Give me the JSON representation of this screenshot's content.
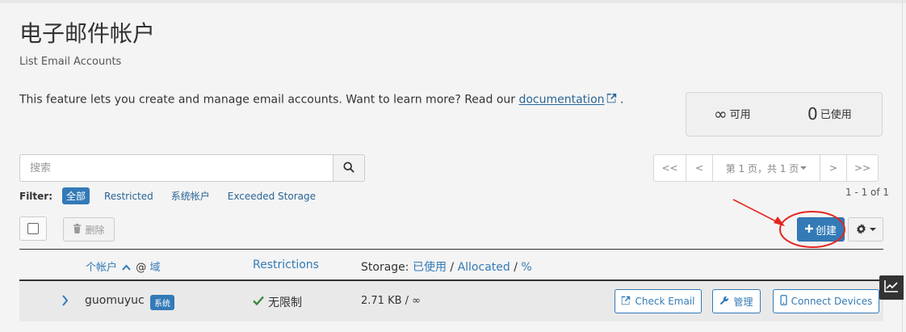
{
  "header": {
    "title": "电子邮件帐户",
    "subtitle": "List Email Accounts"
  },
  "intro": {
    "text": "This feature lets you create and manage email accounts. Want to learn more? Read our ",
    "link_label": "documentation",
    "trailing": "."
  },
  "stats": {
    "available_value": "∞",
    "available_label": "可用",
    "used_value": "0",
    "used_label": "已使用"
  },
  "search": {
    "placeholder": "搜索",
    "icon": "search-icon"
  },
  "pagination": {
    "first": "<<",
    "prev": "<",
    "page_label": "第 1 页，共 1 页",
    "next": ">",
    "last": ">>",
    "range": "1 - 1 of 1"
  },
  "filter": {
    "label": "Filter:",
    "items": [
      {
        "label": "全部",
        "active": true
      },
      {
        "label": "Restricted",
        "active": false
      },
      {
        "label": "系统帐户",
        "active": false
      },
      {
        "label": "Exceeded Storage",
        "active": false
      }
    ]
  },
  "toolbar": {
    "delete_label": "删除",
    "create_label": "创建",
    "create_icon": "plus-icon",
    "settings_icon": "gear-icon"
  },
  "table": {
    "headers": {
      "account": "个帐户",
      "at_sign": "@",
      "domain": "域",
      "restrictions": "Restrictions",
      "storage_prefix": "Storage: ",
      "used": "已使用",
      "separator": " / ",
      "allocated": "Allocated",
      "percent": "%"
    },
    "rows": [
      {
        "account": "guomuyuc",
        "badge": "系统",
        "restriction": "无限制",
        "storage": "2.71 KB / ∞",
        "actions": {
          "check_email": "Check Email",
          "manage": "管理",
          "connect": "Connect Devices"
        }
      }
    ]
  },
  "colors": {
    "primary": "#337ab7",
    "annotation": "#e3261f",
    "success": "#3c8b3c"
  }
}
